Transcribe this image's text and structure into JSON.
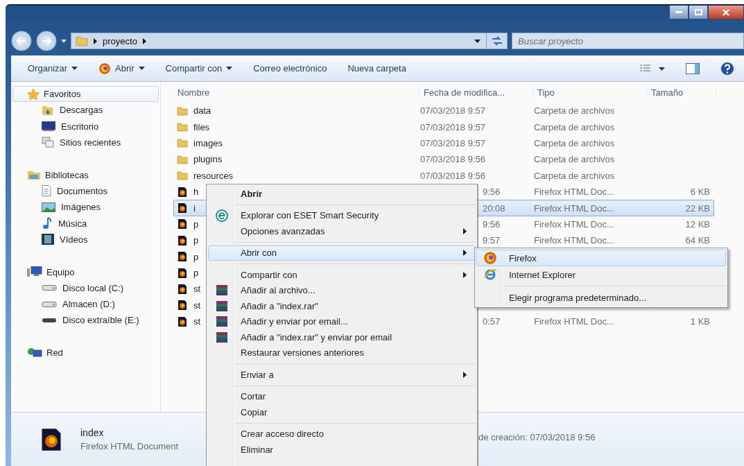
{
  "address": {
    "crumbs": [
      "proyecto"
    ]
  },
  "search": {
    "placeholder": "Buscar proyecto"
  },
  "toolbar": [
    {
      "label": "Organizar",
      "dropdown": true
    },
    {
      "label": "Abrir",
      "dropdown": true
    },
    {
      "label": "Compartir con",
      "dropdown": true
    },
    {
      "label": "Correo electrónico",
      "dropdown": false
    },
    {
      "label": "Nueva carpeta",
      "dropdown": false
    }
  ],
  "nav": [
    {
      "label": "Favoritos",
      "selected": true,
      "children": [
        {
          "label": "Descargas"
        },
        {
          "label": "Escritorio"
        },
        {
          "label": "Sitios recientes"
        }
      ]
    },
    {
      "label": "Bibliotecas",
      "selected": false,
      "children": [
        {
          "label": "Documentos"
        },
        {
          "label": "Imágenes"
        },
        {
          "label": "Música"
        },
        {
          "label": "Vídeos"
        }
      ]
    },
    {
      "label": "Equipo",
      "selected": false,
      "children": [
        {
          "label": "Disco local (C:)"
        },
        {
          "label": "Almacen (D:)"
        },
        {
          "label": "Disco extraíble (E:)"
        }
      ]
    },
    {
      "label": "Red",
      "selected": false
    }
  ],
  "columns": [
    "Nombre",
    "Fecha de modifica...",
    "Tipo",
    "Tamaño"
  ],
  "files": [
    {
      "kind": "folder",
      "name": "data",
      "date": "07/03/2018 9:57",
      "type": "Carpeta de archivos",
      "selected": false
    },
    {
      "kind": "folder",
      "name": "files",
      "date": "07/03/2018 9:57",
      "type": "Carpeta de archivos",
      "selected": false
    },
    {
      "kind": "folder",
      "name": "images",
      "date": "07/03/2018 9:57",
      "type": "Carpeta de archivos",
      "selected": false
    },
    {
      "kind": "folder",
      "name": "plugins",
      "date": "07/03/2018 9:56",
      "type": "Carpeta de archivos",
      "selected": false
    },
    {
      "kind": "folder",
      "name": "resources",
      "date": "07/03/2018 9:56",
      "type": "Carpeta de archivos",
      "selected": false
    },
    {
      "kind": "html",
      "name": "h",
      "date": "9:56",
      "type": "Firefox HTML Doc...",
      "size": "6 KB",
      "selected": false
    },
    {
      "kind": "html",
      "name": "i",
      "date": "20:08",
      "type": "Firefox HTML Doc...",
      "size": "22 KB",
      "selected": true
    },
    {
      "kind": "html",
      "name": "p",
      "date": "9:56",
      "type": "Firefox HTML Doc...",
      "size": "12 KB",
      "selected": false
    },
    {
      "kind": "html",
      "name": "p",
      "date": "9:57",
      "type": "Firefox HTML Doc...",
      "size": "64 KB",
      "selected": false
    },
    {
      "kind": "html",
      "name": "p",
      "selected": false
    },
    {
      "kind": "html",
      "name": "p",
      "selected": false
    },
    {
      "kind": "html",
      "name": "st",
      "selected": false
    },
    {
      "kind": "html",
      "name": "st",
      "selected": false
    },
    {
      "kind": "html",
      "name": "st",
      "date": "0:57",
      "type": "Firefox HTML Doc...",
      "size": "1 KB",
      "selected": false
    }
  ],
  "details": {
    "name": "index",
    "type": "Firefox HTML Document",
    "created": "de creación: 07/03/2018 9:56"
  },
  "context_menu": [
    {
      "kind": "item",
      "label": "Abrir",
      "bold": true,
      "submenu": false,
      "selected": false
    },
    {
      "kind": "separator"
    },
    {
      "kind": "item",
      "label": "Explorar con ESET Smart Security",
      "bold": false,
      "submenu": false,
      "selected": false
    },
    {
      "kind": "item",
      "label": "Opciones avanzadas",
      "bold": false,
      "submenu": true,
      "selected": false
    },
    {
      "kind": "separator"
    },
    {
      "kind": "item",
      "label": "Abrir con",
      "bold": false,
      "submenu": true,
      "selected": true
    },
    {
      "kind": "separator"
    },
    {
      "kind": "item",
      "label": "Compartir con",
      "bold": false,
      "submenu": true,
      "selected": false
    },
    {
      "kind": "item",
      "label": "Añadir al archivo...",
      "bold": false,
      "submenu": false,
      "selected": false
    },
    {
      "kind": "item",
      "label": "Añadir a \"index.rar\"",
      "bold": false,
      "submenu": false,
      "selected": false
    },
    {
      "kind": "item",
      "label": "Añadir y enviar por email...",
      "bold": false,
      "submenu": false,
      "selected": false
    },
    {
      "kind": "item",
      "label": "Añadir a \"index.rar\" y enviar por email",
      "bold": false,
      "submenu": false,
      "selected": false
    },
    {
      "kind": "item",
      "label": "Restaurar versiones anteriores",
      "bold": false,
      "submenu": false,
      "selected": false
    },
    {
      "kind": "separator"
    },
    {
      "kind": "item",
      "label": "Enviar a",
      "bold": false,
      "submenu": true,
      "selected": false
    },
    {
      "kind": "separator"
    },
    {
      "kind": "item",
      "label": "Cortar",
      "bold": false,
      "submenu": false,
      "selected": false
    },
    {
      "kind": "item",
      "label": "Copiar",
      "bold": false,
      "submenu": false,
      "selected": false
    },
    {
      "kind": "separator"
    },
    {
      "kind": "item",
      "label": "Crear acceso directo",
      "bold": false,
      "submenu": false,
      "selected": false
    },
    {
      "kind": "item",
      "label": "Eliminar",
      "bold": false,
      "submenu": false,
      "selected": false
    }
  ],
  "submenu": [
    {
      "kind": "item",
      "label": "Firefox",
      "selected": true
    },
    {
      "kind": "item",
      "label": "Internet Explorer",
      "selected": false
    },
    {
      "kind": "separator"
    },
    {
      "kind": "item",
      "label": "Elegir programa predeterminado...",
      "selected": false
    }
  ]
}
